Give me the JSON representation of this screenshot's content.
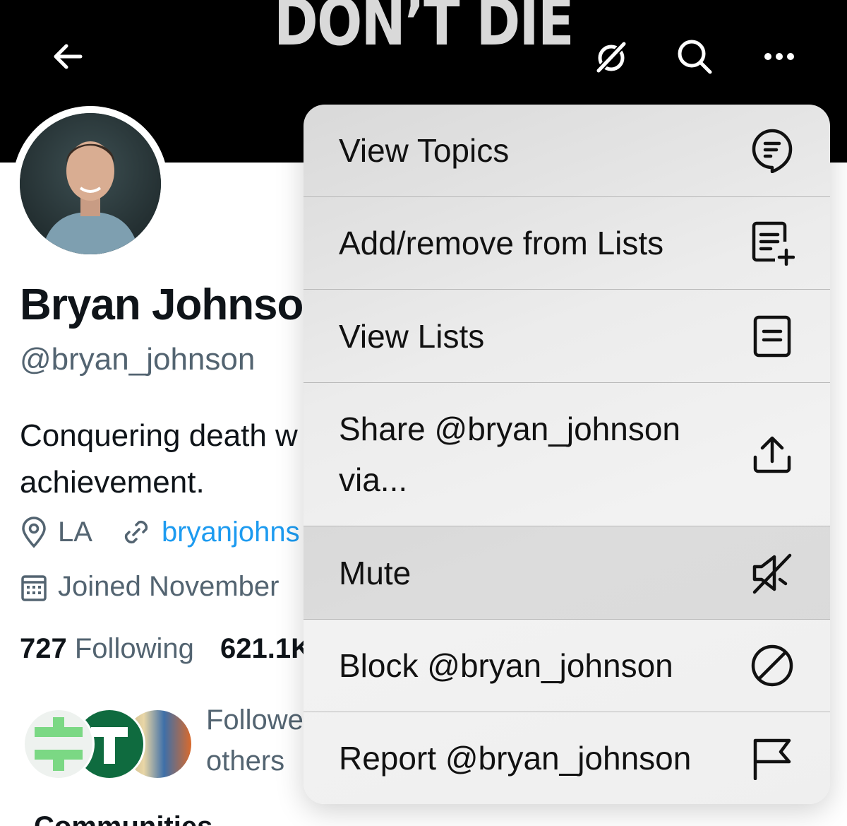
{
  "header": {
    "banner_text": "DON’T DIE"
  },
  "profile": {
    "name": "Bryan Johnson",
    "handle": "@bryan_johnson",
    "bio_line1": "Conquering death w",
    "bio_line2": "achievement.",
    "location": "LA",
    "website": "bryanjohns",
    "joined": "Joined November",
    "following_count": "727",
    "following_label": "Following",
    "followers_count": "621.1K",
    "followed_by_line1": "Followe",
    "followed_by_line2": "others",
    "communities_label": "Communities"
  },
  "menu": {
    "items": [
      {
        "label": "View Topics",
        "icon": "topics-icon"
      },
      {
        "label": "Add/remove from Lists",
        "icon": "list-add-icon"
      },
      {
        "label": "View Lists",
        "icon": "list-icon"
      },
      {
        "label": "Share @bryan_johnson via...",
        "icon": "share-icon"
      },
      {
        "label": "Mute",
        "icon": "mute-icon"
      },
      {
        "label": "Block @bryan_johnson",
        "icon": "block-icon"
      },
      {
        "label": "Report @bryan_johnson",
        "icon": "flag-icon"
      }
    ]
  },
  "colors": {
    "link": "#1d9bf0",
    "text_primary": "#0f1419",
    "text_secondary": "#536471"
  }
}
